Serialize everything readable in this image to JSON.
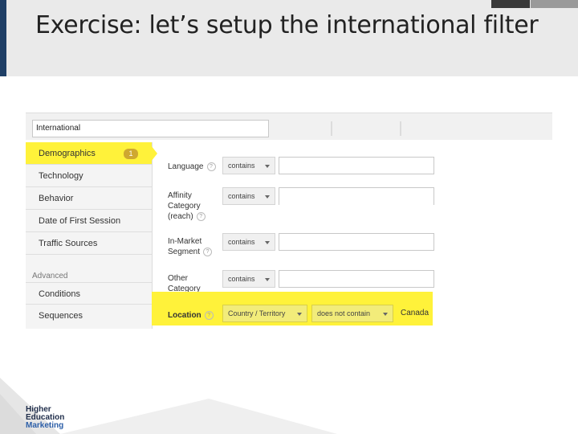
{
  "slide": {
    "title": "Exercise: let’s setup the international filter"
  },
  "search": {
    "value": "International"
  },
  "sidebar": {
    "items": [
      {
        "label": "Demographics",
        "badge": "1"
      },
      {
        "label": "Technology"
      },
      {
        "label": "Behavior"
      },
      {
        "label": "Date of First Session"
      },
      {
        "label": "Traffic Sources"
      }
    ],
    "advanced_header": "Advanced",
    "advanced_items": [
      {
        "label": "Conditions"
      },
      {
        "label": "Sequences"
      }
    ]
  },
  "form": {
    "rows": [
      {
        "label": "Language",
        "operator": "contains",
        "value": ""
      },
      {
        "label": "Affinity Category (reach)",
        "operator": "contains",
        "value": ""
      },
      {
        "label": "In-Market Segment",
        "operator": "contains",
        "value": ""
      },
      {
        "label": "Other Category",
        "operator": "contains",
        "value": ""
      }
    ],
    "location": {
      "label": "Location",
      "dimension": "Country / Territory",
      "operator": "does not contain",
      "value": "Canada"
    },
    "help_glyph": "?"
  },
  "logo": {
    "line1": "Higher",
    "line2": "Education",
    "line3": "Marketing"
  },
  "colors": {
    "highlight": "#fff23a",
    "header_bg": "#eaeaea",
    "accent": "#1f3f66",
    "badge": "#cfa830"
  }
}
